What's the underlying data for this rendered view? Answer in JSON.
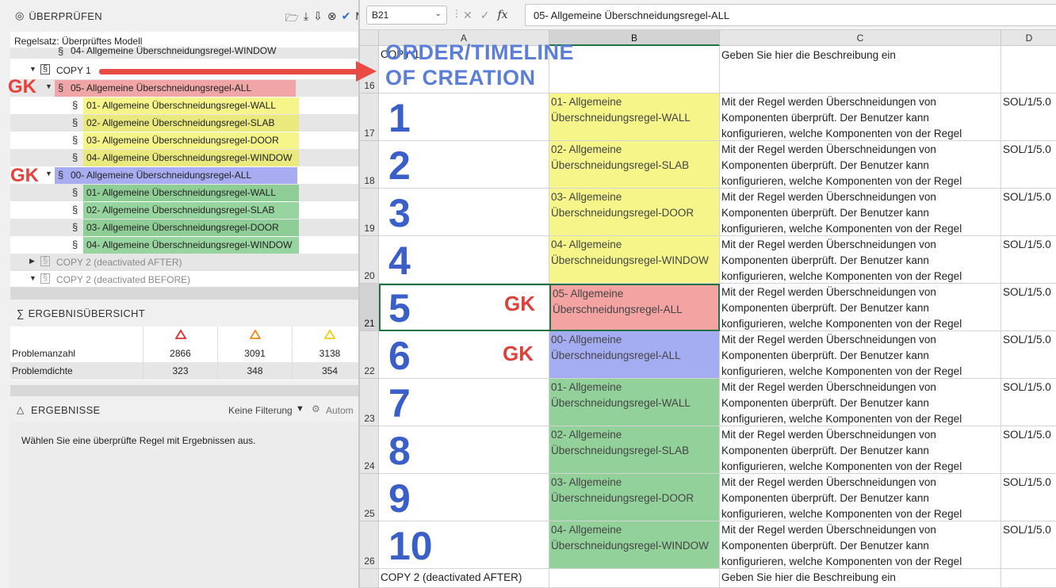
{
  "left_panel": {
    "title": "ÜBERPRÜFEN",
    "header_trailing_letter": "M",
    "ruleset_label": "Regelsatz: Überprüftes Modell",
    "tree": {
      "top_partial_item": "04- Allgemeine Überschneidungsregel-WINDOW",
      "copy1_label": "COPY 1",
      "group_red": {
        "label": "05- Allgemeine Überschneidungsregel-ALL",
        "children": [
          "01- Allgemeine Überschneidungsregel-WALL",
          "02- Allgemeine Überschneidungsregel-SLAB",
          "03- Allgemeine Überschneidungsregel-DOOR",
          "04- Allgemeine Überschneidungsregel-WINDOW"
        ]
      },
      "group_blue": {
        "label": "00- Allgemeine Überschneidungsregel-ALL",
        "children": [
          "01- Allgemeine Überschneidungsregel-WALL",
          "02- Allgemeine Überschneidungsregel-SLAB",
          "03- Allgemeine Überschneidungsregel-DOOR",
          "04- Allgemeine Überschneidungsregel-WINDOW"
        ]
      },
      "copy2_after": "COPY 2 (deactivated AFTER)",
      "copy2_before": "COPY 2 (deactivated BEFORE)"
    },
    "gk_annotation": "GK",
    "summary": {
      "title": "ERGEBNISÜBERSICHT",
      "rows": [
        {
          "label": "Problemanzahl",
          "values": [
            "2866",
            "3091",
            "3138"
          ]
        },
        {
          "label": "Problemdichte",
          "values": [
            "323",
            "348",
            "354"
          ]
        }
      ],
      "severity_colors": [
        "#e03030",
        "#f08a1c",
        "#f0d010"
      ]
    },
    "results": {
      "title": "ERGEBNISSE",
      "filter_label": "Keine Filterung",
      "auto_label": "Autom",
      "empty_message": "Wählen Sie eine überprüfte Regel mit Ergebnissen aus."
    }
  },
  "spreadsheet": {
    "name_box": "B21",
    "formula_value": "05- Allgemeine Überschneidungsregel-ALL",
    "columns": [
      "A",
      "B",
      "C",
      "D"
    ],
    "overlay_title_line1": "ORDER/TIMELINE",
    "overlay_title_line2": "OF CREATION",
    "gk_annotation": "GK",
    "header_row": {
      "row": "16",
      "a": "COPY 1",
      "c": "Geben Sie hier die Beschreibung ein"
    },
    "desc_text": "Mit der Regel werden Überschneidungen von\nKomponenten überprüft. Der Benutzer kann\nkonfigurieren, welche Komponenten von der Regel",
    "d_text": "SOL/1/5.0",
    "rows": [
      {
        "row": "17",
        "num": "1",
        "b": "01- Allgemeine\nÜberschneidungsregel-WALL"
      },
      {
        "row": "18",
        "num": "2",
        "b": "02- Allgemeine\nÜberschneidungsregel-SLAB"
      },
      {
        "row": "19",
        "num": "3",
        "b": "03- Allgemeine\nÜberschneidungsregel-DOOR"
      },
      {
        "row": "20",
        "num": "4",
        "b": "04- Allgemeine\nÜberschneidungsregel-WINDOW"
      },
      {
        "row": "21",
        "num": "5",
        "b": "05- Allgemeine\nÜberschneidungsregel-ALL"
      },
      {
        "row": "22",
        "num": "6",
        "b": "00- Allgemeine\nÜberschneidungsregel-ALL"
      },
      {
        "row": "23",
        "num": "7",
        "b": "01- Allgemeine\nÜberschneidungsregel-WALL"
      },
      {
        "row": "24",
        "num": "8",
        "b": "02- Allgemeine\nÜberschneidungsregel-SLAB"
      },
      {
        "row": "25",
        "num": "9",
        "b": "03- Allgemeine\nÜberschneidungsregel-DOOR"
      },
      {
        "row": "26",
        "num": "10",
        "b": "04- Allgemeine\nÜberschneidungsregel-WINDOW"
      }
    ],
    "last_row": {
      "a": "COPY 2 (deactivated AFTER)",
      "c": "Geben Sie hier die Beschreibung ein"
    },
    "colors": {
      "yellow": "#f5f58a",
      "red": "#f4a3a3",
      "blue": "#a5adf2",
      "green": "#93d19b",
      "accent": "#217346"
    }
  }
}
